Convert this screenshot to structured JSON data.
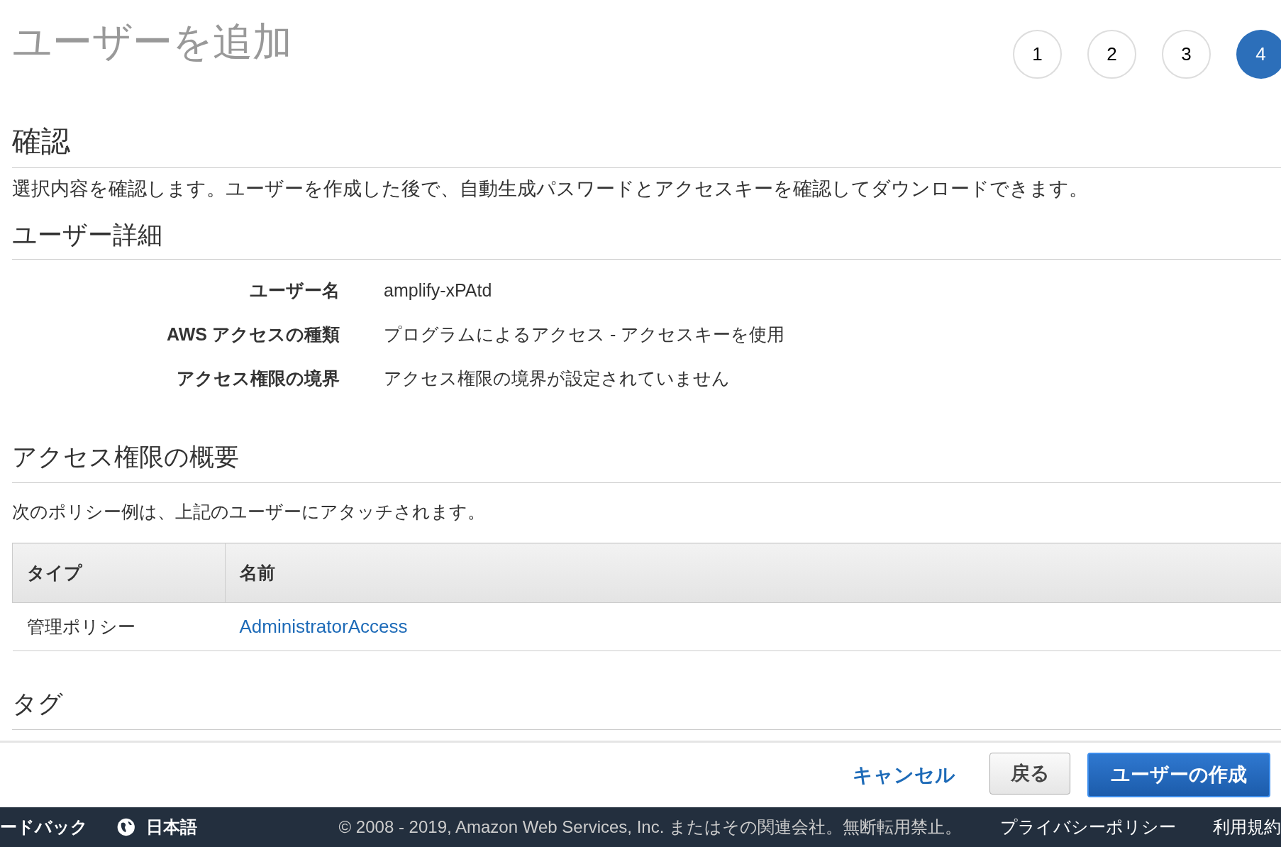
{
  "page_title": "ユーザーを追加",
  "steps": [
    {
      "label": "1",
      "selected": false
    },
    {
      "label": "2",
      "selected": false
    },
    {
      "label": "3",
      "selected": false
    },
    {
      "label": "4",
      "selected": true
    }
  ],
  "review": {
    "heading": "確認",
    "description": "選択内容を確認します。ユーザーを作成した後で、自動生成パスワードとアクセスキーを確認してダウンロードできます。"
  },
  "user_details": {
    "heading": "ユーザー詳細",
    "rows": [
      {
        "label": "ユーザー名",
        "value": "amplify-xPAtd"
      },
      {
        "label": "AWS アクセスの種類",
        "value": "プログラムによるアクセス - アクセスキーを使用"
      },
      {
        "label": "アクセス権限の境界",
        "value": "アクセス権限の境界が設定されていません"
      }
    ]
  },
  "permissions": {
    "heading": "アクセス権限の概要",
    "description": "次のポリシー例は、上記のユーザーにアタッチされます。",
    "table": {
      "columns": [
        "タイプ",
        "名前"
      ],
      "rows": [
        {
          "type": "管理ポリシー",
          "name": "AdministratorAccess"
        }
      ]
    }
  },
  "tags": {
    "heading": "タグ"
  },
  "actions": {
    "cancel": "キャンセル",
    "back": "戻る",
    "create": "ユーザーの作成"
  },
  "footer": {
    "feedback": "ードバック",
    "language": "日本語",
    "copyright": "© 2008 - 2019, Amazon Web Services, Inc. またはその関連会社。無断転用禁止。",
    "privacy": "プライバシーポリシー",
    "terms": "利用規約"
  }
}
